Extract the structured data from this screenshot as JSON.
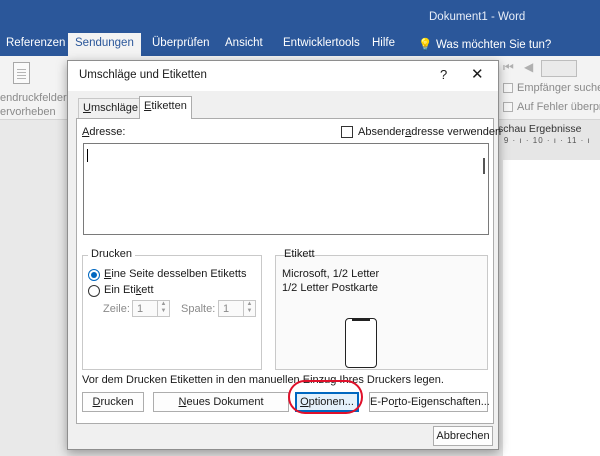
{
  "word": {
    "doc_title": "Dokument1 - Word",
    "tabs": [
      "Referenzen",
      "Sendungen",
      "Überprüfen",
      "Ansicht",
      "Entwicklertools",
      "Hilfe"
    ],
    "tell_me": "Was möchten Sie tun?",
    "ribbon": {
      "highlight_fields_line1": "endruckfelder",
      "highlight_fields_line2": "ervorheben",
      "find_recipient": "Empfänger suchen",
      "check_errors": "Auf Fehler überprü",
      "preview_results": "schau Ergebnisse"
    },
    "ruler": "· 9 · ı · 10 · ı · 11 · ı"
  },
  "dialog": {
    "title": "Umschläge und Etiketten",
    "help": "?",
    "close": "✕",
    "tab_envelopes": {
      "pre": "",
      "key": "U",
      "post": "mschläge"
    },
    "tab_labels": {
      "pre": "",
      "key": "E",
      "post": "tiketten"
    },
    "address_label": {
      "pre": "",
      "key": "A",
      "post": "dresse:"
    },
    "use_return_address": {
      "pre": "Absender",
      "key": "a",
      "post": "dresse verwenden",
      "checked": false
    },
    "address_value": "",
    "print_group": {
      "title": "Drucken",
      "full_page": {
        "pre": "",
        "key": "E",
        "post": "ine Seite desselben Etiketts",
        "selected": true
      },
      "single_label": {
        "pre": "Ein Eti",
        "key": "k",
        "post": "ett",
        "selected": false
      },
      "row_label": "Zeile:",
      "row_value": "1",
      "column_label": "Spalte:",
      "column_value": "1"
    },
    "label_group": {
      "title": "Etikett",
      "line1": "Microsoft, 1/2 Letter",
      "line2": "1/2 Letter Postkarte"
    },
    "instruction": "Vor dem Drucken Etiketten in den manuellen Einzug Ihres Druckers legen.",
    "buttons": {
      "print": {
        "pre": "",
        "key": "D",
        "post": "rucken"
      },
      "new_document": {
        "pre": "",
        "key": "N",
        "post": "eues Dokument"
      },
      "options": {
        "pre": "",
        "key": "O",
        "post": "ptionen..."
      },
      "epostage": {
        "pre": "E-Po",
        "key": "r",
        "post": "to-Eigenschaften..."
      },
      "cancel": "Abbrechen"
    }
  },
  "annotation": {
    "color": "#e0102a"
  },
  "colors": {
    "word_blue": "#2b579a",
    "accent": "#0067c0"
  }
}
